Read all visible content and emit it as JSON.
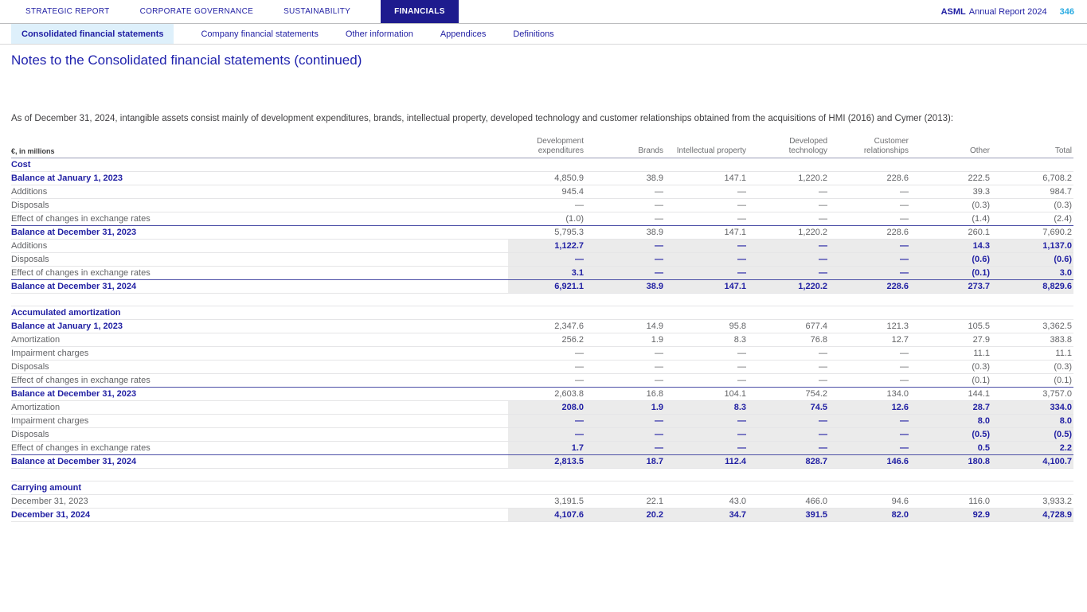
{
  "header": {
    "nav": [
      {
        "label": "STRATEGIC REPORT",
        "active": false
      },
      {
        "label": "CORPORATE GOVERNANCE",
        "active": false
      },
      {
        "label": "SUSTAINABILITY",
        "active": false
      },
      {
        "label": "FINANCIALS",
        "active": true
      }
    ],
    "brand": {
      "name": "ASML",
      "report": "Annual Report 2024",
      "page": "346"
    },
    "subnav": [
      {
        "label": "Consolidated financial statements",
        "active": true
      },
      {
        "label": "Company financial statements",
        "active": false
      },
      {
        "label": "Other information",
        "active": false
      },
      {
        "label": "Appendices",
        "active": false
      },
      {
        "label": "Definitions",
        "active": false
      }
    ]
  },
  "page": {
    "title": "Notes to the Consolidated financial statements (continued)",
    "intro": "As of December 31, 2024, intangible assets consist mainly of development expenditures, brands, intellectual property, developed technology and customer relationships obtained from the acquisitions of HMI (2016) and Cymer (2013):"
  },
  "colors": {
    "navy": "#1e1b8e",
    "accent_cyan": "#29abe2",
    "highlight_bg": "#ebebeb"
  },
  "table": {
    "unit_label": "€, in millions",
    "columns": [
      {
        "lines": [
          "Development",
          "expenditures"
        ]
      },
      {
        "lines": [
          "Brands"
        ]
      },
      {
        "lines": [
          "Intellectual property"
        ]
      },
      {
        "lines": [
          "Developed",
          "technology"
        ]
      },
      {
        "lines": [
          "Customer",
          "relationships"
        ]
      },
      {
        "lines": [
          "Other"
        ]
      },
      {
        "lines": [
          "Total"
        ]
      }
    ],
    "rows": [
      {
        "label": "Cost",
        "bold": true,
        "section": true,
        "values": [
          "",
          "",
          "",
          "",
          "",
          "",
          ""
        ]
      },
      {
        "label": "Balance at January 1, 2023",
        "bold": true,
        "values": [
          "4,850.9",
          "38.9",
          "147.1",
          "1,220.2",
          "228.6",
          "222.5",
          "6,708.2"
        ]
      },
      {
        "label": "Additions",
        "values": [
          "945.4",
          "—",
          "—",
          "—",
          "—",
          "39.3",
          "984.7"
        ]
      },
      {
        "label": "Disposals",
        "values": [
          "—",
          "—",
          "—",
          "—",
          "—",
          "(0.3)",
          "(0.3)"
        ]
      },
      {
        "label": "Effect of changes in exchange rates",
        "values": [
          "(1.0)",
          "—",
          "—",
          "—",
          "—",
          "(1.4)",
          "(2.4)"
        ]
      },
      {
        "label": "Balance at December 31, 2023",
        "bold": true,
        "topline": true,
        "values": [
          "5,795.3",
          "38.9",
          "147.1",
          "1,220.2",
          "228.6",
          "260.1",
          "7,690.2"
        ]
      },
      {
        "label": "Additions",
        "highlight": true,
        "values": [
          "1,122.7",
          "—",
          "—",
          "—",
          "—",
          "14.3",
          "1,137.0"
        ]
      },
      {
        "label": "Disposals",
        "highlight": true,
        "values": [
          "—",
          "—",
          "—",
          "—",
          "—",
          "(0.6)",
          "(0.6)"
        ]
      },
      {
        "label": "Effect of changes in exchange rates",
        "highlight": true,
        "values": [
          "3.1",
          "—",
          "—",
          "—",
          "—",
          "(0.1)",
          "3.0"
        ]
      },
      {
        "label": "Balance at December 31, 2024",
        "bold": true,
        "highlight": true,
        "topline": true,
        "values": [
          "6,921.1",
          "38.9",
          "147.1",
          "1,220.2",
          "228.6",
          "273.7",
          "8,829.6"
        ]
      },
      {
        "spacer": true
      },
      {
        "label": "Accumulated amortization",
        "bold": true,
        "section": true,
        "values": [
          "",
          "",
          "",
          "",
          "",
          "",
          ""
        ]
      },
      {
        "label": "Balance at January 1, 2023",
        "bold": true,
        "values": [
          "2,347.6",
          "14.9",
          "95.8",
          "677.4",
          "121.3",
          "105.5",
          "3,362.5"
        ]
      },
      {
        "label": "Amortization",
        "values": [
          "256.2",
          "1.9",
          "8.3",
          "76.8",
          "12.7",
          "27.9",
          "383.8"
        ]
      },
      {
        "label": "Impairment charges",
        "values": [
          "—",
          "—",
          "—",
          "—",
          "—",
          "11.1",
          "11.1"
        ]
      },
      {
        "label": "Disposals",
        "values": [
          "—",
          "—",
          "—",
          "—",
          "—",
          "(0.3)",
          "(0.3)"
        ]
      },
      {
        "label": "Effect of changes in exchange rates",
        "values": [
          "—",
          "—",
          "—",
          "—",
          "—",
          "(0.1)",
          "(0.1)"
        ]
      },
      {
        "label": "Balance at December 31, 2023",
        "bold": true,
        "topline": true,
        "values": [
          "2,603.8",
          "16.8",
          "104.1",
          "754.2",
          "134.0",
          "144.1",
          "3,757.0"
        ]
      },
      {
        "label": "Amortization",
        "highlight": true,
        "values": [
          "208.0",
          "1.9",
          "8.3",
          "74.5",
          "12.6",
          "28.7",
          "334.0"
        ]
      },
      {
        "label": "Impairment charges",
        "highlight": true,
        "values": [
          "—",
          "—",
          "—",
          "—",
          "—",
          "8.0",
          "8.0"
        ]
      },
      {
        "label": "Disposals",
        "highlight": true,
        "values": [
          "—",
          "—",
          "—",
          "—",
          "—",
          "(0.5)",
          "(0.5)"
        ]
      },
      {
        "label": "Effect of changes in exchange rates",
        "highlight": true,
        "values": [
          "1.7",
          "—",
          "—",
          "—",
          "—",
          "0.5",
          "2.2"
        ]
      },
      {
        "label": "Balance at December 31, 2024",
        "bold": true,
        "highlight": true,
        "topline": true,
        "values": [
          "2,813.5",
          "18.7",
          "112.4",
          "828.7",
          "146.6",
          "180.8",
          "4,100.7"
        ]
      },
      {
        "spacer": true
      },
      {
        "label": "Carrying amount",
        "bold": true,
        "section": true,
        "values": [
          "",
          "",
          "",
          "",
          "",
          "",
          ""
        ]
      },
      {
        "label": "December 31, 2023",
        "values": [
          "3,191.5",
          "22.1",
          "43.0",
          "466.0",
          "94.6",
          "116.0",
          "3,933.2"
        ]
      },
      {
        "label": "December 31, 2024",
        "bold": true,
        "highlight": true,
        "values": [
          "4,107.6",
          "20.2",
          "34.7",
          "391.5",
          "82.0",
          "92.9",
          "4,728.9"
        ]
      }
    ]
  }
}
